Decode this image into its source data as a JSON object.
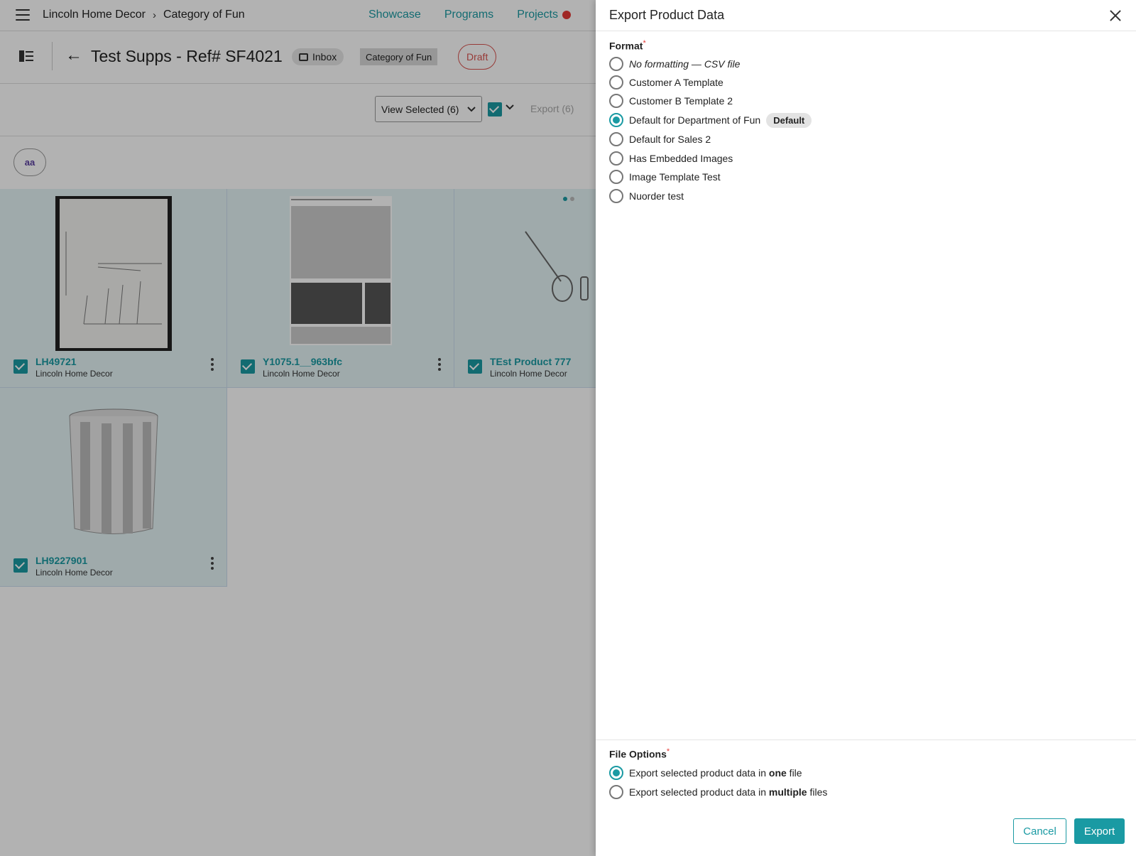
{
  "topbar": {
    "breadcrumb": [
      "Lincoln Home Decor",
      "Category of Fun"
    ],
    "nav": [
      {
        "label": "Showcase"
      },
      {
        "label": "Programs"
      },
      {
        "label": "Projects"
      }
    ]
  },
  "header": {
    "title": "Test Supps - Ref# SF4021",
    "inbox_chip": "Inbox",
    "category_chip": "Category of Fun",
    "status_chip": "Draft"
  },
  "toolbar": {
    "view_selected": "View Selected (6)",
    "export_label": "Export (6)"
  },
  "avatar": "aa",
  "products": [
    {
      "name": "LH49721",
      "vendor": "Lincoln Home Decor",
      "checked": true
    },
    {
      "name": "Y1075.1__963bfc",
      "vendor": "Lincoln Home Decor",
      "checked": true
    },
    {
      "name": "TEst Product 777",
      "vendor": "Lincoln Home Decor",
      "checked": true
    },
    {
      "name": "LH9227901",
      "vendor": "Lincoln Home Decor",
      "checked": true
    }
  ],
  "drawer": {
    "title": "Export Product Data",
    "format_label": "Format",
    "required_mark": "*",
    "formats": [
      {
        "label": "No formatting — CSV file",
        "selected": false
      },
      {
        "label": "Customer A Template",
        "selected": false
      },
      {
        "label": "Customer B Template 2",
        "selected": false
      },
      {
        "label": "Default for Department of Fun",
        "selected": true,
        "badge": "Default"
      },
      {
        "label": "Default for Sales 2",
        "selected": false
      },
      {
        "label": "Has Embedded Images",
        "selected": false
      },
      {
        "label": "Image Template Test",
        "selected": false
      },
      {
        "label": "Nuorder test",
        "selected": false
      }
    ],
    "file_options_label": "File Options",
    "file_options": [
      {
        "prefix": "Export selected product data in ",
        "bold": "one",
        "suffix": " file",
        "selected": true
      },
      {
        "prefix": "Export selected product data in ",
        "bold": "multiple",
        "suffix": " files",
        "selected": false
      }
    ],
    "cancel_label": "Cancel",
    "export_label": "Export"
  },
  "colors": {
    "accent": "#1a9aa3",
    "draft": "#d9534f",
    "notification": "#e53935"
  }
}
